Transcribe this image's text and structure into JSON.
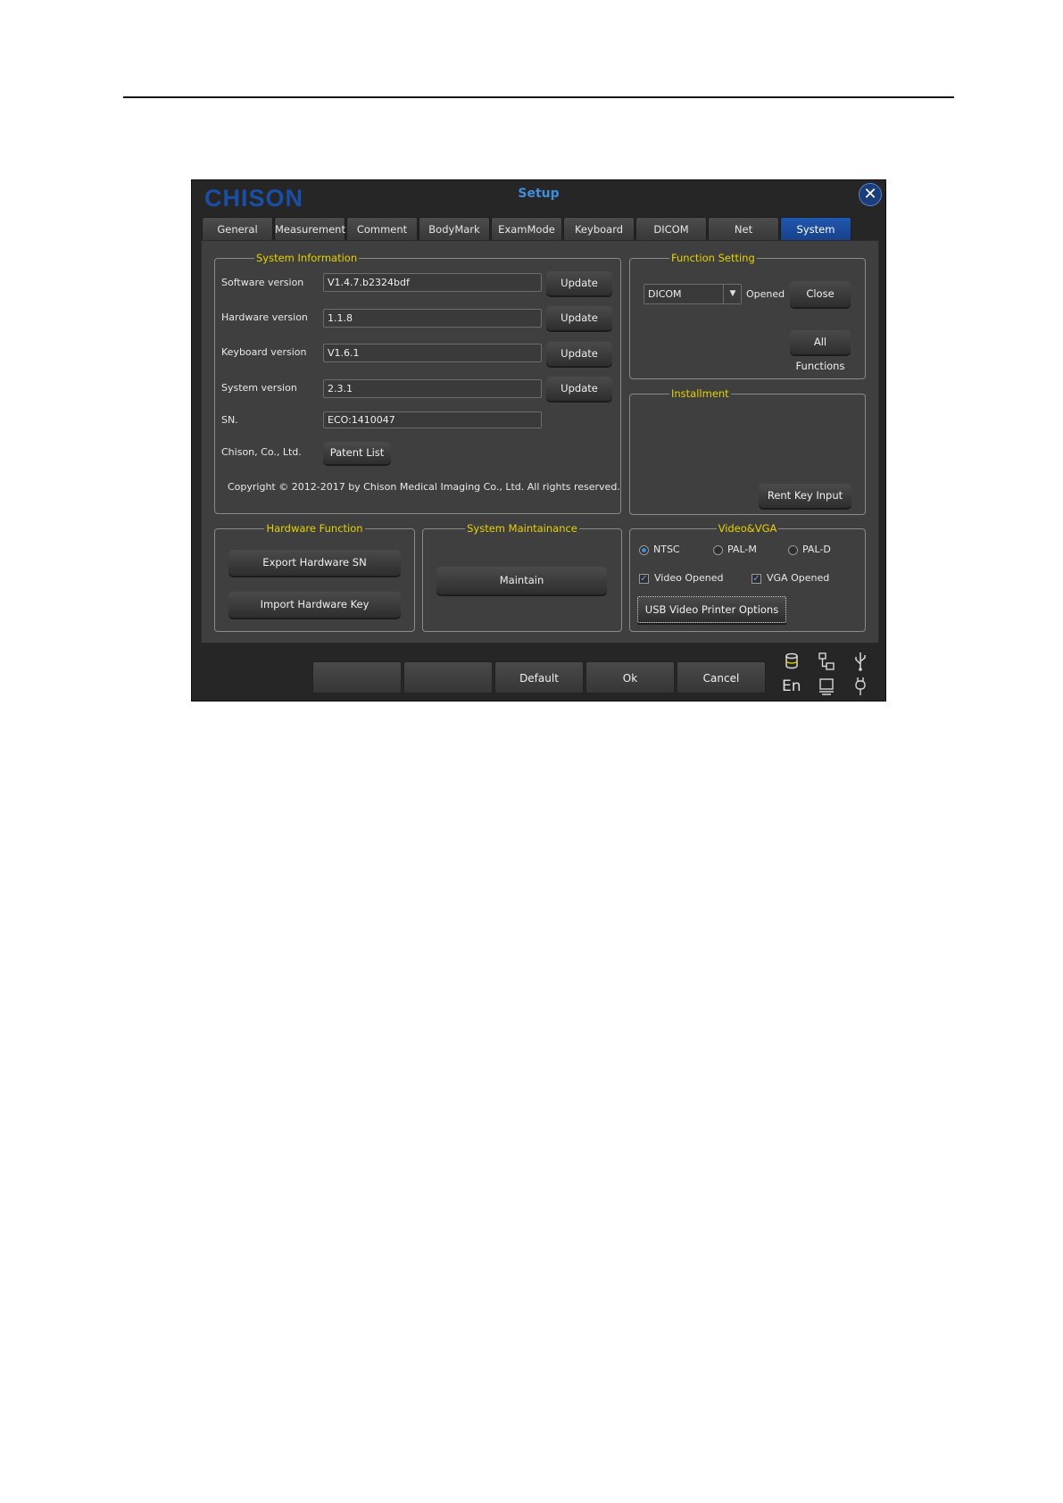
{
  "window": {
    "brand": "CHISON",
    "title": "Setup",
    "close_glyph": "✕"
  },
  "tabs": [
    "General",
    "Measurement",
    "Comment",
    "BodyMark",
    "ExamMode",
    "Keyboard",
    "DICOM",
    "Net",
    "System"
  ],
  "active_tab": "System",
  "system_info": {
    "legend": "System Information",
    "rows": [
      {
        "label": "Software version",
        "value": "V1.4.7.b2324bdf",
        "button": "Update"
      },
      {
        "label": "Hardware version",
        "value": "1.1.8",
        "button": "Update"
      },
      {
        "label": "Keyboard version",
        "value": "V1.6.1",
        "button": "Update"
      },
      {
        "label": "System version",
        "value": "2.3.1",
        "button": "Update"
      }
    ],
    "sn_label": "SN.",
    "sn_value": "ECO:1410047",
    "company_label": "Chison, Co., Ltd.",
    "patent_button": "Patent List",
    "copyright": "Copyright © 2012-2017 by Chison Medical Imaging Co., Ltd. All rights reserved."
  },
  "function_setting": {
    "legend": "Function Setting",
    "selected": "DICOM",
    "dropdown_glyph": "▼",
    "status": "Opened",
    "close_button": "Close",
    "all_functions_button": "All Functions"
  },
  "installment": {
    "legend": "Installment",
    "rent_key_button": "Rent Key Input"
  },
  "hardware_function": {
    "legend": "Hardware Function",
    "export_button": "Export Hardware SN",
    "import_button": "Import Hardware Key"
  },
  "system_maintainance": {
    "legend": "System Maintainance",
    "maintain_button": "Maintain"
  },
  "video_vga": {
    "legend": "Video&VGA",
    "radios": [
      {
        "label": "NTSC",
        "checked": true
      },
      {
        "label": "PAL-M",
        "checked": false
      },
      {
        "label": "PAL-D",
        "checked": false
      }
    ],
    "checkboxes": [
      {
        "label": "Video Opened",
        "checked": true
      },
      {
        "label": "VGA Opened",
        "checked": true
      }
    ],
    "check_glyph": "✓",
    "usb_printer_button": "USB Video Printer Options"
  },
  "footer": {
    "buttons": [
      "",
      "",
      "Default",
      "Ok",
      "Cancel"
    ],
    "language": "En",
    "icons": [
      "database-icon",
      "network-icon",
      "usb-icon",
      "display-icon",
      "probe-icon"
    ]
  },
  "colors": {
    "legend_yellow": "#e6d300",
    "active_tab_blue": "#1c4d9e",
    "title_blue": "#3f8ddc",
    "brand_blue": "#1a4fa8"
  }
}
